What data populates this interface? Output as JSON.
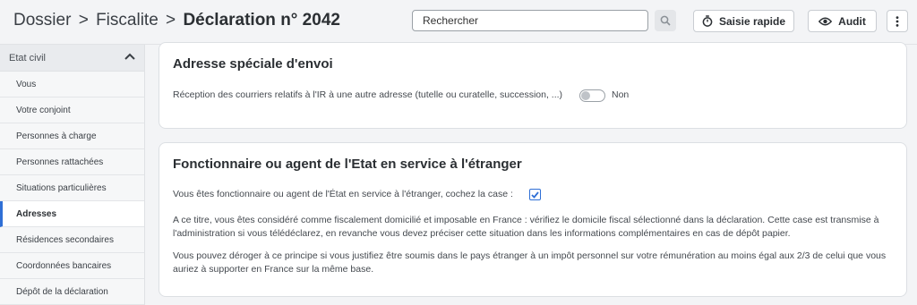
{
  "header": {
    "breadcrumb": [
      "Dossier",
      "Fiscalite"
    ],
    "separator": ">",
    "current": "Déclaration n° 2042",
    "search_placeholder": "Rechercher",
    "saisie_label": "Saisie rapide",
    "audit_label": "Audit"
  },
  "sidebar": {
    "section_label": "Etat civil",
    "items": [
      {
        "label": "Vous",
        "active": false
      },
      {
        "label": "Votre conjoint",
        "active": false
      },
      {
        "label": "Personnes à charge",
        "active": false
      },
      {
        "label": "Personnes rattachées",
        "active": false
      },
      {
        "label": "Situations particulières",
        "active": false
      },
      {
        "label": "Adresses",
        "active": true
      },
      {
        "label": "Résidences secondaires",
        "active": false
      },
      {
        "label": "Coordonnées bancaires",
        "active": false
      },
      {
        "label": "Dépôt de la déclaration",
        "active": false
      }
    ]
  },
  "card1": {
    "title": "Adresse spéciale d'envoi",
    "question": "Réception des courriers relatifs à l'IR à une autre adresse (tutelle ou curatelle, succession, ...)",
    "toggle_on": false,
    "toggle_value": "Non"
  },
  "card2": {
    "title": "Fonctionnaire ou agent de l'Etat en service à l'étranger",
    "question": "Vous êtes fonctionnaire ou agent de l'État en service à l'étranger, cochez la case :",
    "checked": true,
    "para1": "A ce titre, vous êtes considéré comme fiscalement domicilié et imposable en France : vérifiez le domicile fiscal sélectionné dans la déclaration. Cette case est transmise à l'administration si vous télédéclarez, en revanche vous devez préciser cette situation dans les informations complémentaires en cas de dépôt papier.",
    "para2": "Vous pouvez déroger à ce principe si vous justifiez être soumis dans le pays étranger à un impôt personnel sur votre rémunération au moins égal aux 2/3 de celui que vous auriez à supporter en France sur la même base."
  },
  "colors": {
    "accent": "#2f6fd6"
  }
}
